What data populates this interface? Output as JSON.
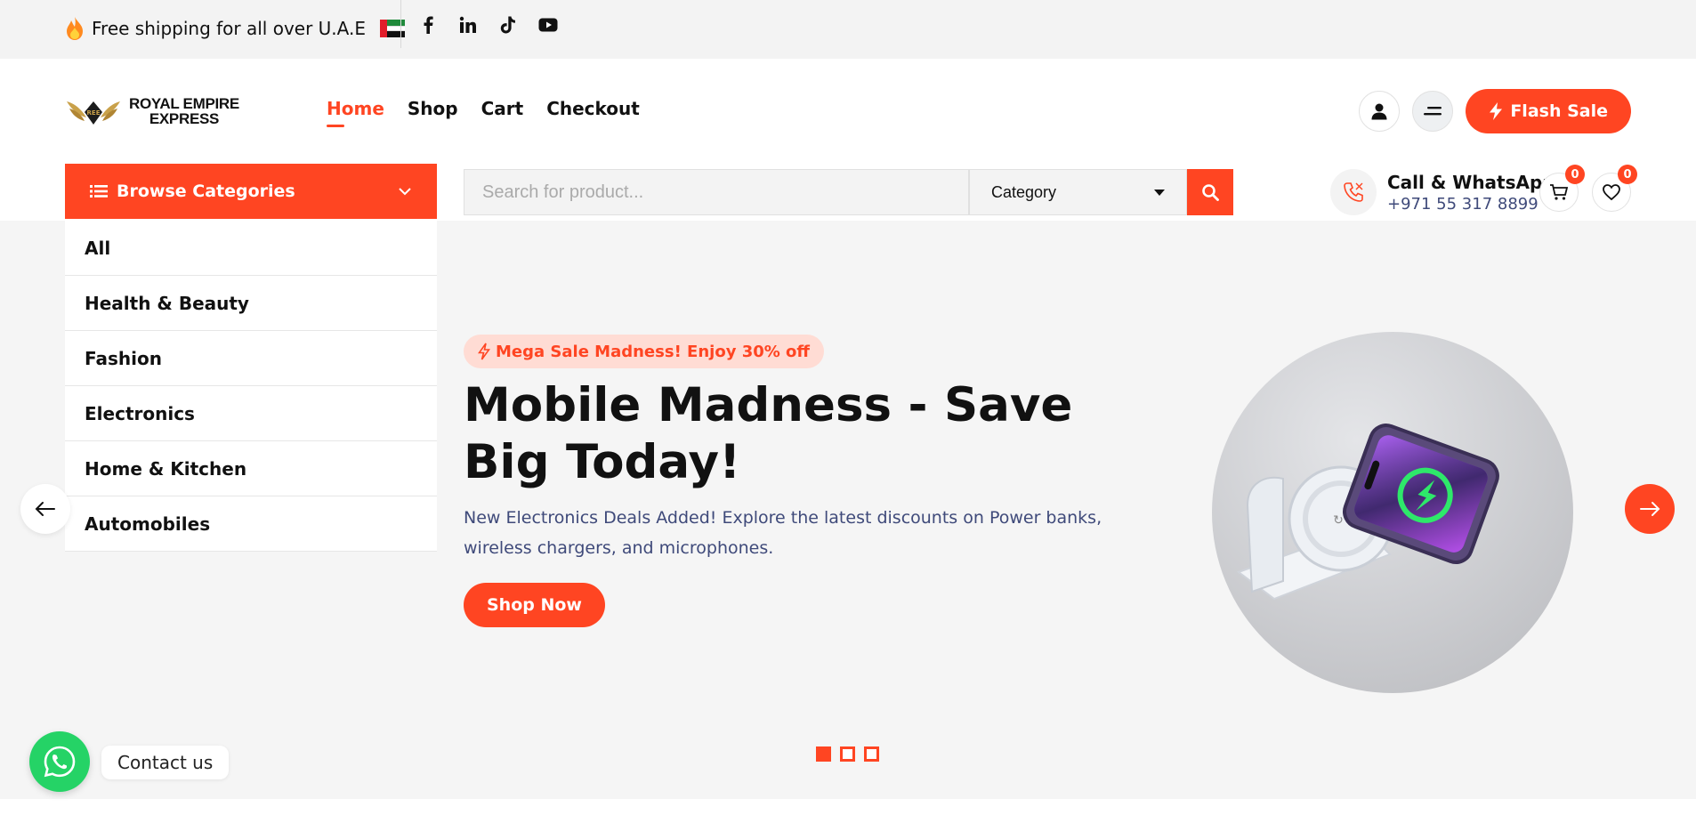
{
  "topbar": {
    "promo_text": "Free shipping for all over U.A.E",
    "social": [
      "facebook-icon",
      "linkedin-icon",
      "tiktok-icon",
      "youtube-icon"
    ]
  },
  "logo": {
    "line1": "ROYAL EMPIRE",
    "line2": "EXPRESS"
  },
  "nav": {
    "home": "Home",
    "shop": "Shop",
    "cart": "Cart",
    "checkout": "Checkout"
  },
  "header": {
    "flash_sale": "Flash Sale"
  },
  "browse": {
    "label": "Browse Categories"
  },
  "search": {
    "placeholder": "Search for product...",
    "category": "Category"
  },
  "contact": {
    "title": "Call & WhatsApp",
    "phone": "+971 55 317 8899"
  },
  "counts": {
    "cart": "0",
    "wishlist": "0"
  },
  "categories": [
    "All",
    "Health & Beauty",
    "Fashion",
    "Electronics",
    "Home & Kitchen",
    "Automobiles"
  ],
  "hero": {
    "pill": "Mega Sale Madness! Enjoy 30% off",
    "title": "Mobile Madness - Save Big Today!",
    "description": "New Electronics Deals Added! Explore the latest discounts on Power banks, wireless chargers, and microphones.",
    "button": "Shop Now"
  },
  "whatsapp": {
    "label": "Contact us"
  },
  "colors": {
    "accent": "#ff4522",
    "whatsapp": "#25d366",
    "text_blue": "#3f4a7a"
  }
}
